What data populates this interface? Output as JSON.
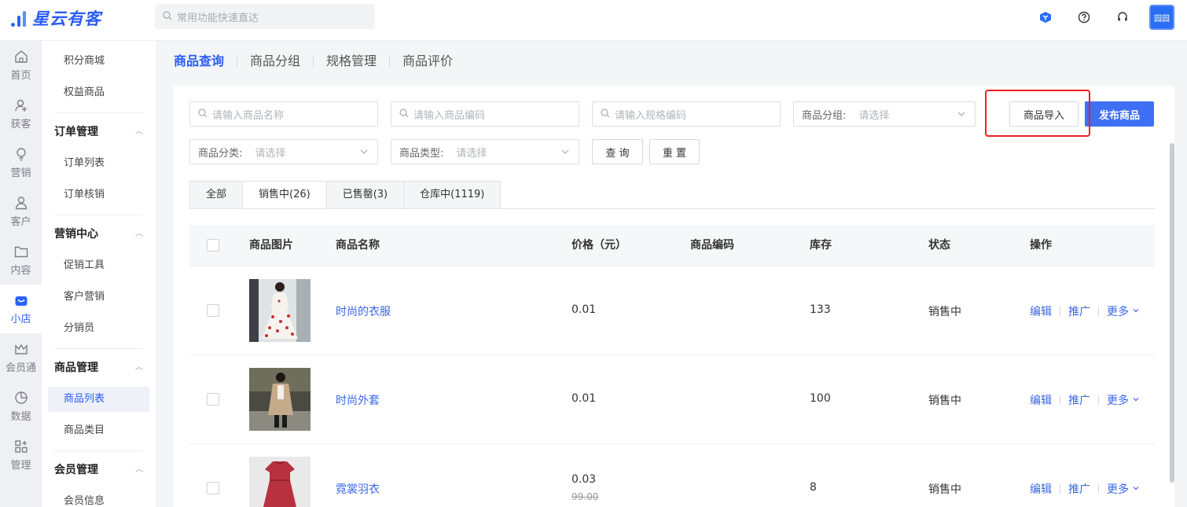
{
  "app": {
    "logo_text": "星云有客",
    "search_placeholder": "常用功能快速直达",
    "avatar_text": "园园"
  },
  "leftnav": [
    {
      "label": "首页",
      "icon": "home-icon"
    },
    {
      "label": "获客",
      "icon": "user-add-icon"
    },
    {
      "label": "营销",
      "icon": "bulb-icon"
    },
    {
      "label": "客户",
      "icon": "person-icon"
    },
    {
      "label": "内容",
      "icon": "folder-icon"
    },
    {
      "label": "小店",
      "icon": "shop-icon",
      "active": true
    },
    {
      "label": "会员通",
      "icon": "crown-icon"
    },
    {
      "label": "数据",
      "icon": "pie-icon"
    },
    {
      "label": "管理",
      "icon": "grid-icon"
    }
  ],
  "subnav": {
    "top_items": [
      "积分商城",
      "权益商品"
    ],
    "groups": [
      {
        "title": "订单管理",
        "items": [
          "订单列表",
          "订单核销"
        ]
      },
      {
        "title": "营销中心",
        "items": [
          "促销工具",
          "客户营销",
          "分销员"
        ]
      },
      {
        "title": "商品管理",
        "items": [
          "商品列表",
          "商品类目"
        ]
      },
      {
        "title": "会员管理",
        "items": [
          "会员信息"
        ]
      }
    ],
    "active": "商品列表"
  },
  "page_tabs": [
    "商品查询",
    "商品分组",
    "规格管理",
    "商品评价"
  ],
  "filters": {
    "name_placeholder": "请输入商品名称",
    "code_placeholder": "请输入商品编码",
    "spec_placeholder": "请输入规格编码",
    "group_label": "商品分组:",
    "category_label": "商品分类:",
    "type_label": "商品类型:",
    "select_placeholder": "请选择",
    "query_btn": "查 询",
    "reset_btn": "重 置",
    "import_btn": "商品导入",
    "publish_btn": "发布商品"
  },
  "status_tabs": [
    "全部",
    "销售中(26)",
    "已售罄(3)",
    "仓库中(1119)"
  ],
  "active_status_tab": "销售中(26)",
  "table": {
    "headers": {
      "image": "商品图片",
      "name": "商品名称",
      "price": "价格（元）",
      "code": "商品编码",
      "stock": "库存",
      "status": "状态",
      "ops": "操作"
    },
    "rows": [
      {
        "name": "时尚的衣服",
        "price": "0.01",
        "original_price": "",
        "code": "",
        "stock": "133",
        "status": "销售中"
      },
      {
        "name": "时尚外套",
        "price": "0.01",
        "original_price": "",
        "code": "",
        "stock": "100",
        "status": "销售中"
      },
      {
        "name": "霓裳羽衣",
        "price": "0.03",
        "original_price": "99.00",
        "code": "",
        "stock": "8",
        "status": "销售中"
      }
    ],
    "op_labels": {
      "edit": "编辑",
      "promote": "推广",
      "more": "更多"
    }
  },
  "colors": {
    "accent": "#2a5cf6",
    "primary_button": "#3e6ff5",
    "highlight": "#ee2020"
  }
}
